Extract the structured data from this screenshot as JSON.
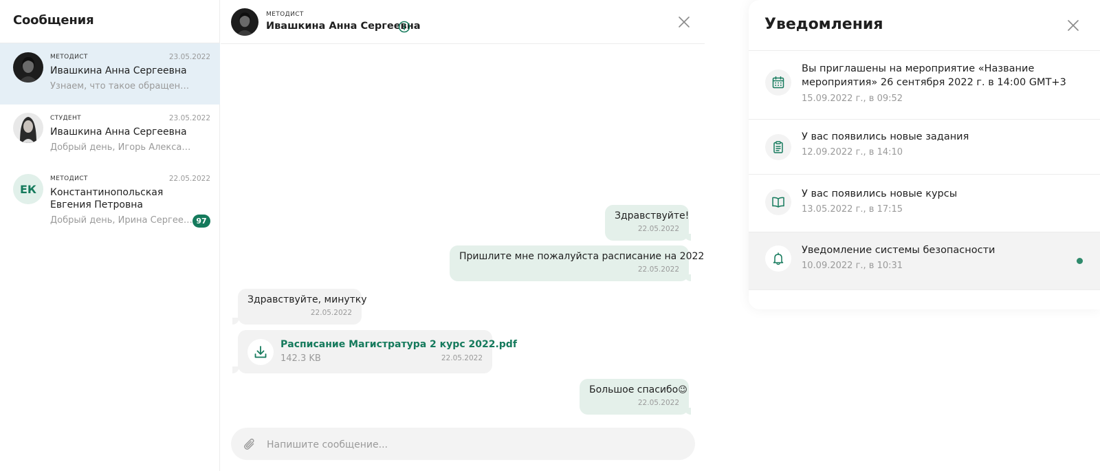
{
  "messages_panel": {
    "title": "Сообщения",
    "conversations": [
      {
        "role": "МЕТОДИСТ",
        "date": "23.05.2022",
        "name": "Ивашкина Анна Сергеевна",
        "preview": "Узнаем, что такое обращение в ...",
        "active": true
      },
      {
        "role": "СТУДЕНТ",
        "date": "23.05.2022",
        "name": "Ивашкина Анна Сергеевна",
        "preview": "Добрый день, Игорь Александ..."
      },
      {
        "role": "МЕТОДИСТ",
        "date": "22.05.2022",
        "name": "Константинопольская Евгения Петровна",
        "preview": "Добрый день, Ирина Сергеевн...",
        "initials": "ЕК",
        "unread": "97"
      }
    ]
  },
  "chat": {
    "role": "МЕТОДИСТ",
    "name": "Ивашкина Анна Сергеевна",
    "messages": [
      {
        "direction": "out",
        "text": "Здравствуйте!",
        "time": "22.05.2022"
      },
      {
        "direction": "out",
        "text": "Пришлите мне пожалуйста расписание на 2022",
        "time": "22.05.2022"
      },
      {
        "direction": "in",
        "text": "Здравствуйте, минутку",
        "time": "22.05.2022"
      },
      {
        "direction": "in",
        "type": "file",
        "file_name": "Расписание Магистратура 2 курс 2022.pdf",
        "file_size": "142.3 KB",
        "time": "22.05.2022"
      },
      {
        "direction": "out",
        "text": "Большое спасибо",
        "emoji": "😉",
        "time": "22.05.2022"
      }
    ],
    "composer": {
      "placeholder": "Напишите сообщение..."
    }
  },
  "notifications_panel": {
    "title": "Уведомления",
    "items": [
      {
        "icon": "calendar-icon",
        "text": "Вы приглашены на мероприятие «Название мероприятия» 26 сентября 2022 г. в 14:00 GMT+3",
        "time": "15.09.2022 г., в 09:52"
      },
      {
        "icon": "clipboard-icon",
        "text": "У вас появились новые задания",
        "time": "12.09.2022 г., в 14:10"
      },
      {
        "icon": "book-icon",
        "text": "У вас появились новые курсы",
        "time": "13.05.2022 г., в 17:15"
      },
      {
        "icon": "bell-icon",
        "text": "Уведомление системы безопасности",
        "time": "10.09.2022 г., в 10:31",
        "unread": true
      }
    ]
  },
  "colors": {
    "accent": "#157a5c",
    "active_conversation_bg": "#e5eff6",
    "outgoing_bubble": "#e4f0ea",
    "incoming_bubble": "#f2f2f2",
    "unread_dot": "#2f8a6c"
  }
}
